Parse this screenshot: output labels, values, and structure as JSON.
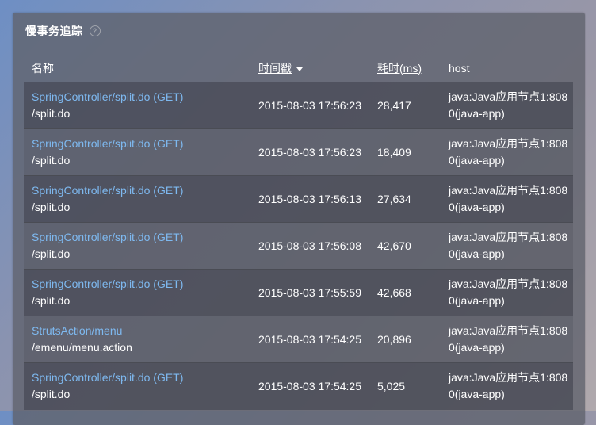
{
  "panel": {
    "title": "慢事务追踪",
    "help_icon": "question-circle-icon"
  },
  "table": {
    "columns": {
      "name": "名称",
      "timestamp": "时间戳",
      "duration": "耗时(ms)",
      "host": "host"
    },
    "rows": [
      {
        "controller": "SpringController/split.do (GET)",
        "path": "/split.do",
        "timestamp": "2015-08-03 17:56:23",
        "duration": "28,417",
        "host": "java:Java应用节点1:8080(java-app)"
      },
      {
        "controller": "SpringController/split.do (GET)",
        "path": "/split.do",
        "timestamp": "2015-08-03 17:56:23",
        "duration": "18,409",
        "host": "java:Java应用节点1:8080(java-app)"
      },
      {
        "controller": "SpringController/split.do (GET)",
        "path": "/split.do",
        "timestamp": "2015-08-03 17:56:13",
        "duration": "27,634",
        "host": "java:Java应用节点1:8080(java-app)"
      },
      {
        "controller": "SpringController/split.do (GET)",
        "path": "/split.do",
        "timestamp": "2015-08-03 17:56:08",
        "duration": "42,670",
        "host": "java:Java应用节点1:8080(java-app)"
      },
      {
        "controller": "SpringController/split.do (GET)",
        "path": "/split.do",
        "timestamp": "2015-08-03 17:55:59",
        "duration": "42,668",
        "host": "java:Java应用节点1:8080(java-app)"
      },
      {
        "controller": "StrutsAction/menu",
        "path": "/emenu/menu.action",
        "timestamp": "2015-08-03 17:54:25",
        "duration": "20,896",
        "host": "java:Java应用节点1:8080(java-app)"
      },
      {
        "controller": "SpringController/split.do (GET)",
        "path": "/split.do",
        "timestamp": "2015-08-03 17:54:25",
        "duration": "5,025",
        "host": "java:Java应用节点1:8080(java-app)"
      }
    ]
  }
}
